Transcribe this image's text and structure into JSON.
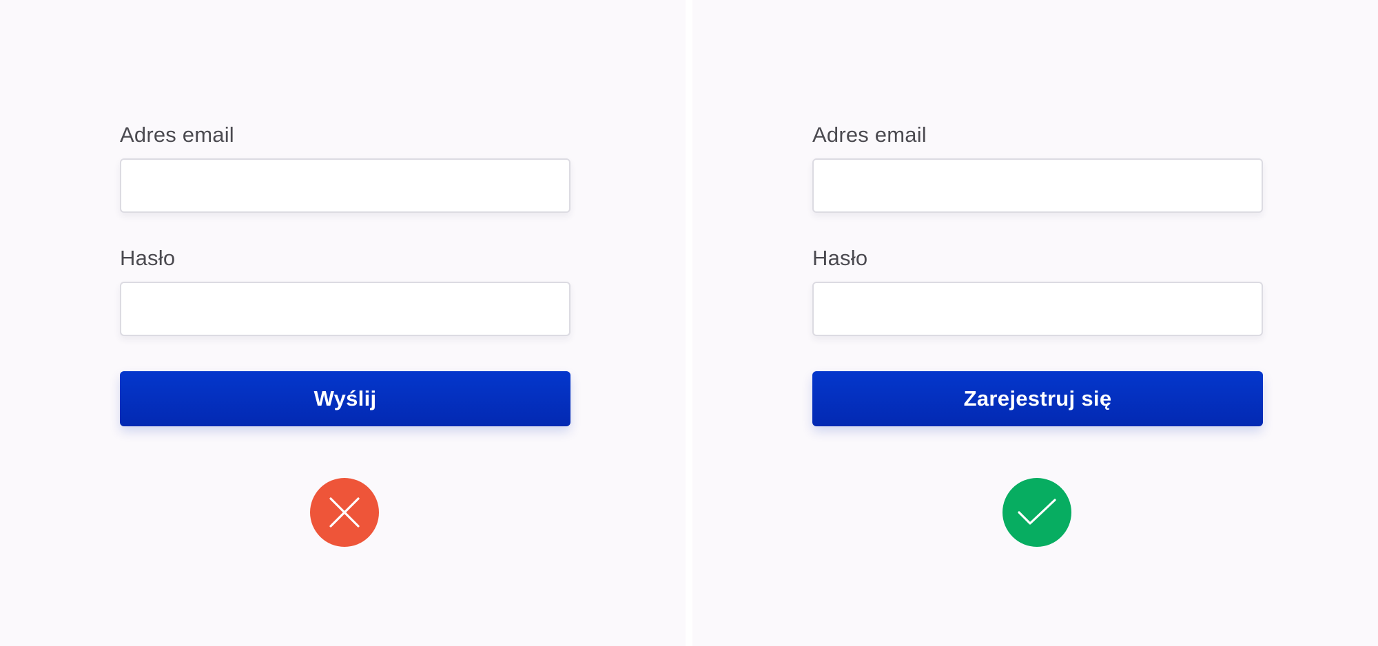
{
  "colors": {
    "background": "#fbf9fc",
    "primary_button": "#0432c2",
    "error": "#ee5539",
    "success": "#07ad61"
  },
  "left_example": {
    "email_label": "Adres email",
    "email_value": "",
    "password_label": "Hasło",
    "password_value": "",
    "submit_label": "Wyślij",
    "status_icon": "x-icon",
    "status_color": "#ee5539"
  },
  "right_example": {
    "email_label": "Adres email",
    "email_value": "",
    "password_label": "Hasło",
    "password_value": "",
    "submit_label": "Zarejestruj się",
    "status_icon": "check-icon",
    "status_color": "#07ad61"
  }
}
